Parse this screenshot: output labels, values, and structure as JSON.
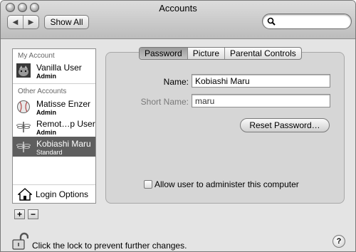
{
  "window": {
    "title": "Accounts"
  },
  "toolbar": {
    "back_glyph": "◀",
    "forward_glyph": "▶",
    "show_all_label": "Show All",
    "search_placeholder": ""
  },
  "sidebar": {
    "my_account_header": "My Account",
    "other_accounts_header": "Other Accounts",
    "accounts": [
      {
        "name": "Vanilla User",
        "role": "Admin",
        "icon": "cat-photo-icon"
      },
      {
        "name": "Matisse Enzer",
        "role": "Admin",
        "icon": "baseball-icon"
      },
      {
        "name": "Remot…p User",
        "role": "Admin",
        "icon": "dragonfly-icon"
      },
      {
        "name": "Kobiashi Maru",
        "role": "Standard",
        "icon": "dragonfly-icon",
        "selected": true
      }
    ],
    "login_options_label": "Login Options",
    "add_label": "+",
    "remove_label": "−"
  },
  "tabs": [
    {
      "label": "Password",
      "active": true
    },
    {
      "label": "Picture",
      "active": false
    },
    {
      "label": "Parental Controls",
      "active": false
    }
  ],
  "form": {
    "name_label": "Name:",
    "name_value": "Kobiashi Maru",
    "short_name_label": "Short Name:",
    "short_name_value": "maru",
    "reset_password_label": "Reset Password…",
    "admin_checkbox_label": "Allow user to administer this computer",
    "admin_checked": false
  },
  "footer": {
    "lock_text": "Click the lock to prevent further changes.",
    "help_label": "?"
  }
}
